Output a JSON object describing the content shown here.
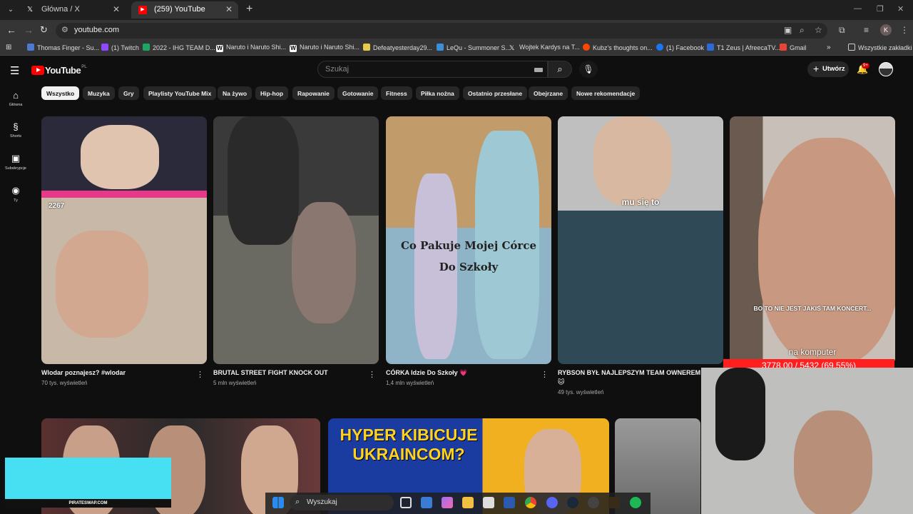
{
  "browser": {
    "tabs": [
      {
        "title": "Główna / X",
        "favicon": "x-icon"
      },
      {
        "title": "(259) YouTube",
        "favicon": "youtube-icon"
      }
    ],
    "url": "youtube.com",
    "profile_initial": "K",
    "bookmarks": [
      "Thomas Finger - Su...",
      "(1) Twitch",
      "2022 - IHG TEAM D...",
      "Naruto i Naruto Shi...",
      "Naruto i Naruto Shi...",
      "Defeatyesterday29...",
      "LeQu - Summoner S...",
      "Wojtek Kardys na T...",
      "Kubz's thoughts on...",
      "(1) Facebook",
      "T1 Zeus | AfreecaTV...",
      "Gmail"
    ],
    "all_bookmarks_label": "Wszystkie zakładki"
  },
  "youtube": {
    "logo_text": "YouTube",
    "logo_region": "PL",
    "search_placeholder": "Szukaj",
    "create_label": "Utwórz",
    "notifications_badge": "9+",
    "leftnav": [
      {
        "label": "Główna",
        "icon": "home-icon"
      },
      {
        "label": "Shorts",
        "icon": "shorts-icon"
      },
      {
        "label": "Subskrypcje",
        "icon": "subscriptions-icon"
      },
      {
        "label": "Ty",
        "icon": "you-icon"
      }
    ],
    "chips": [
      "Wszystko",
      "Muzyka",
      "Gry",
      "Playlisty YouTube Mix",
      "Na żywo",
      "Hip-hop",
      "Rapowanie",
      "Gotowanie",
      "Fitness",
      "Piłka nożna",
      "Ostatnio przesłane",
      "Obejrzane",
      "Nowe rekomendacje"
    ],
    "shorts": [
      {
        "title": "Wlodar poznajesz? #wlodar",
        "views": "70 tys. wyświetleń",
        "overlay": "",
        "counter": "2267"
      },
      {
        "title": "BRUTAL STREET FIGHT KNOCK OUT",
        "views": "5 mln wyświetleń",
        "overlay": ""
      },
      {
        "title": "CÓRKA Idzie Do Szkoły 💗",
        "views": "1,4 mln wyświetleń",
        "overlay": "Co Pakuje Mojej Córce Do Szkoły"
      },
      {
        "title": "RYBSON BYŁ NAJLEPSZYM TEAM OWNEREM 🐱",
        "views": "49 tys. wyświetleń",
        "overlay": "mu się to"
      },
      {
        "title": "",
        "views": "",
        "overlay": "BO TO NIE JEST JAKIŚ TAM KONCERT..."
      }
    ],
    "second_row": [
      {
        "overlay": ""
      },
      {
        "overlay": "HYPER KIBICUJE UKRAINCOM?"
      },
      {
        "overlay": ""
      }
    ]
  },
  "stream_overlay": {
    "caption": "na komputer",
    "counter": "3778.00 / 5432 (69.55%)",
    "sponsor": "PIRATESWAP.COM",
    "accent_color": "#47e0f2"
  },
  "taskbar": {
    "search_label": "Wyszukaj"
  }
}
